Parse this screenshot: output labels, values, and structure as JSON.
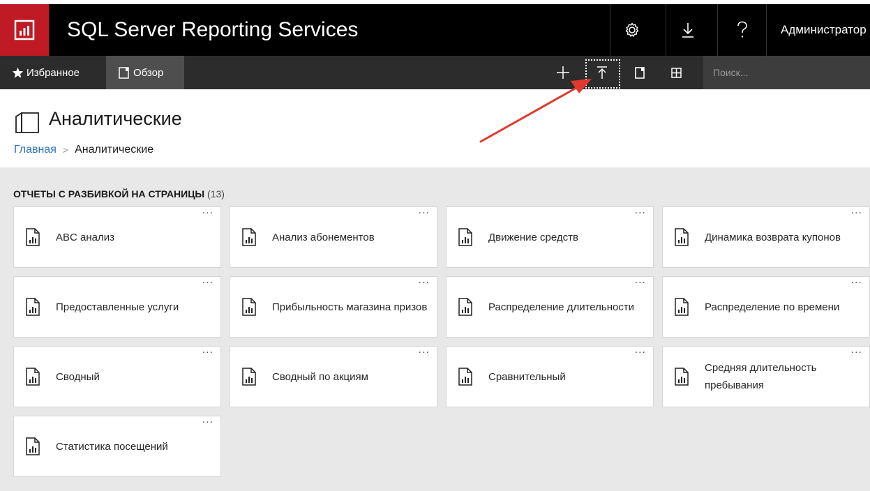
{
  "header": {
    "app_title": "SQL Server Reporting Services",
    "user": "Администратор"
  },
  "nav": {
    "favorites": "Избранное",
    "browse": "Обзор",
    "search_placeholder": "Поиск..."
  },
  "page": {
    "title": "Аналитические",
    "breadcrumb": {
      "home": "Главная",
      "current": "Аналитические"
    }
  },
  "section": {
    "title": "ОТЧЕТЫ С РАЗБИВКОЙ НА СТРАНИЦЫ",
    "count": "(13)"
  },
  "reports": [
    {
      "label": "ABC анализ"
    },
    {
      "label": "Анализ абонементов"
    },
    {
      "label": "Движение средств"
    },
    {
      "label": "Динамика возврата купонов"
    },
    {
      "label": "Предоставленные услуги"
    },
    {
      "label": "Прибыльность магазина призов"
    },
    {
      "label": "Распределение длительности"
    },
    {
      "label": "Распределение по времени"
    },
    {
      "label": "Сводный"
    },
    {
      "label": "Сводный по акциям"
    },
    {
      "label": "Сравнительный"
    },
    {
      "label": "Средняя длительность пребывания"
    },
    {
      "label": "Статистика посещений"
    }
  ],
  "tile_menu": "...",
  "colors": {
    "brand": "#c01a24",
    "annotation_arrow": "#e03a2e",
    "link": "#2f73c6"
  }
}
